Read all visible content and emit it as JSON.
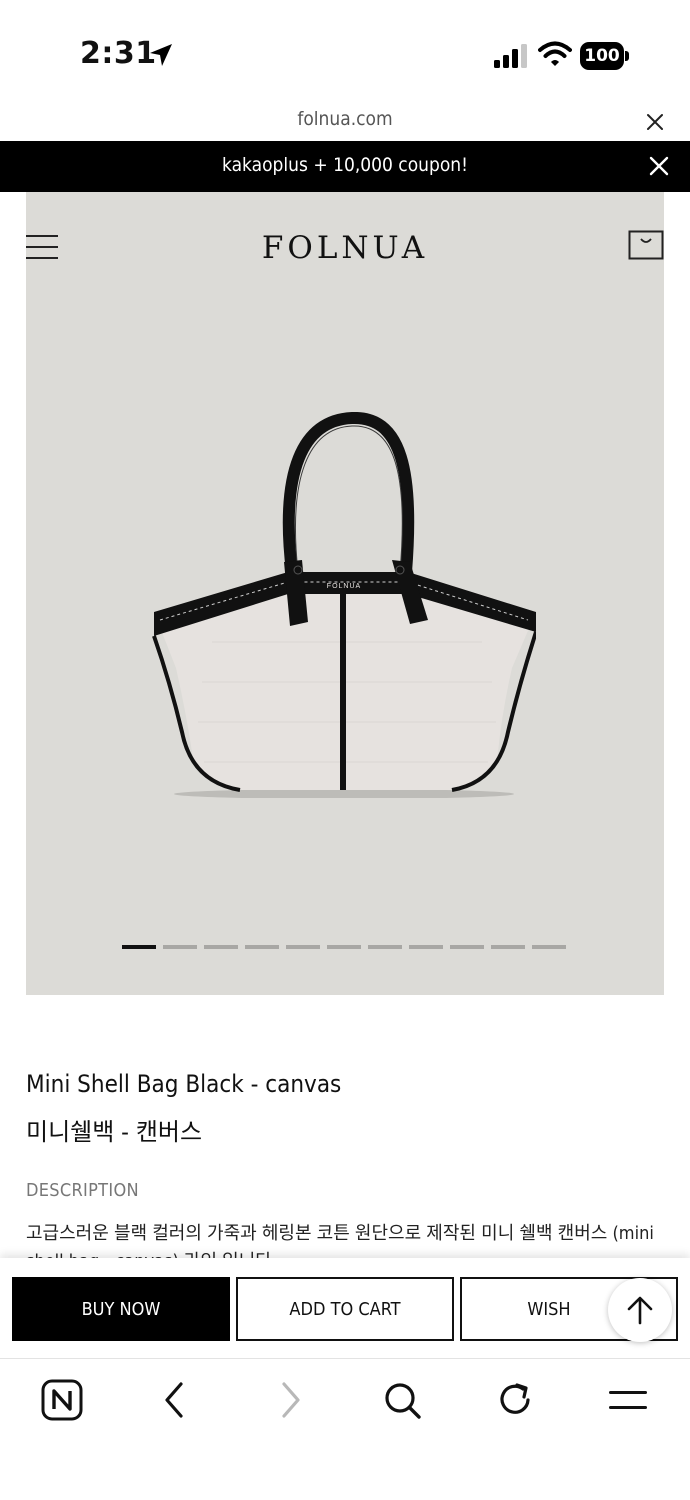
{
  "status_bar": {
    "time": "2:31",
    "battery": "100",
    "icons": [
      "location-arrow-icon",
      "signal-icon",
      "wifi-icon",
      "battery-icon"
    ]
  },
  "browser": {
    "url": "folnua.com"
  },
  "promo": {
    "text": "kakaoplus + 10,000 coupon!"
  },
  "header": {
    "logo": "FOLNUA",
    "icons": [
      "menu-icon",
      "cart-icon"
    ]
  },
  "gallery": {
    "slide_count": 11,
    "active_index": 0,
    "bag_label": "FOLNUA"
  },
  "product": {
    "title": "Mini Shell Bag Black - canvas",
    "subtitle": "미니쉘백 - 캔버스",
    "description_label": "DESCRIPTION",
    "description": "고급스러운 블랙 컬러의 가죽과 헤링본 코튼 원단으로 제작된 미니 쉘백 캔버스 (mini shell bag - canvas) 라인 입니다."
  },
  "actions": {
    "buy_now": "BUY NOW",
    "add_to_cart": "ADD TO CART",
    "wish": "WISH"
  },
  "colors": {
    "hero_bg": "#dcdbd7",
    "primary": "#000000",
    "muted": "#777777"
  },
  "toolbar": {
    "icons": [
      "naver-n-icon",
      "back-icon",
      "forward-icon",
      "search-icon",
      "reload-icon",
      "menu-icon"
    ]
  }
}
